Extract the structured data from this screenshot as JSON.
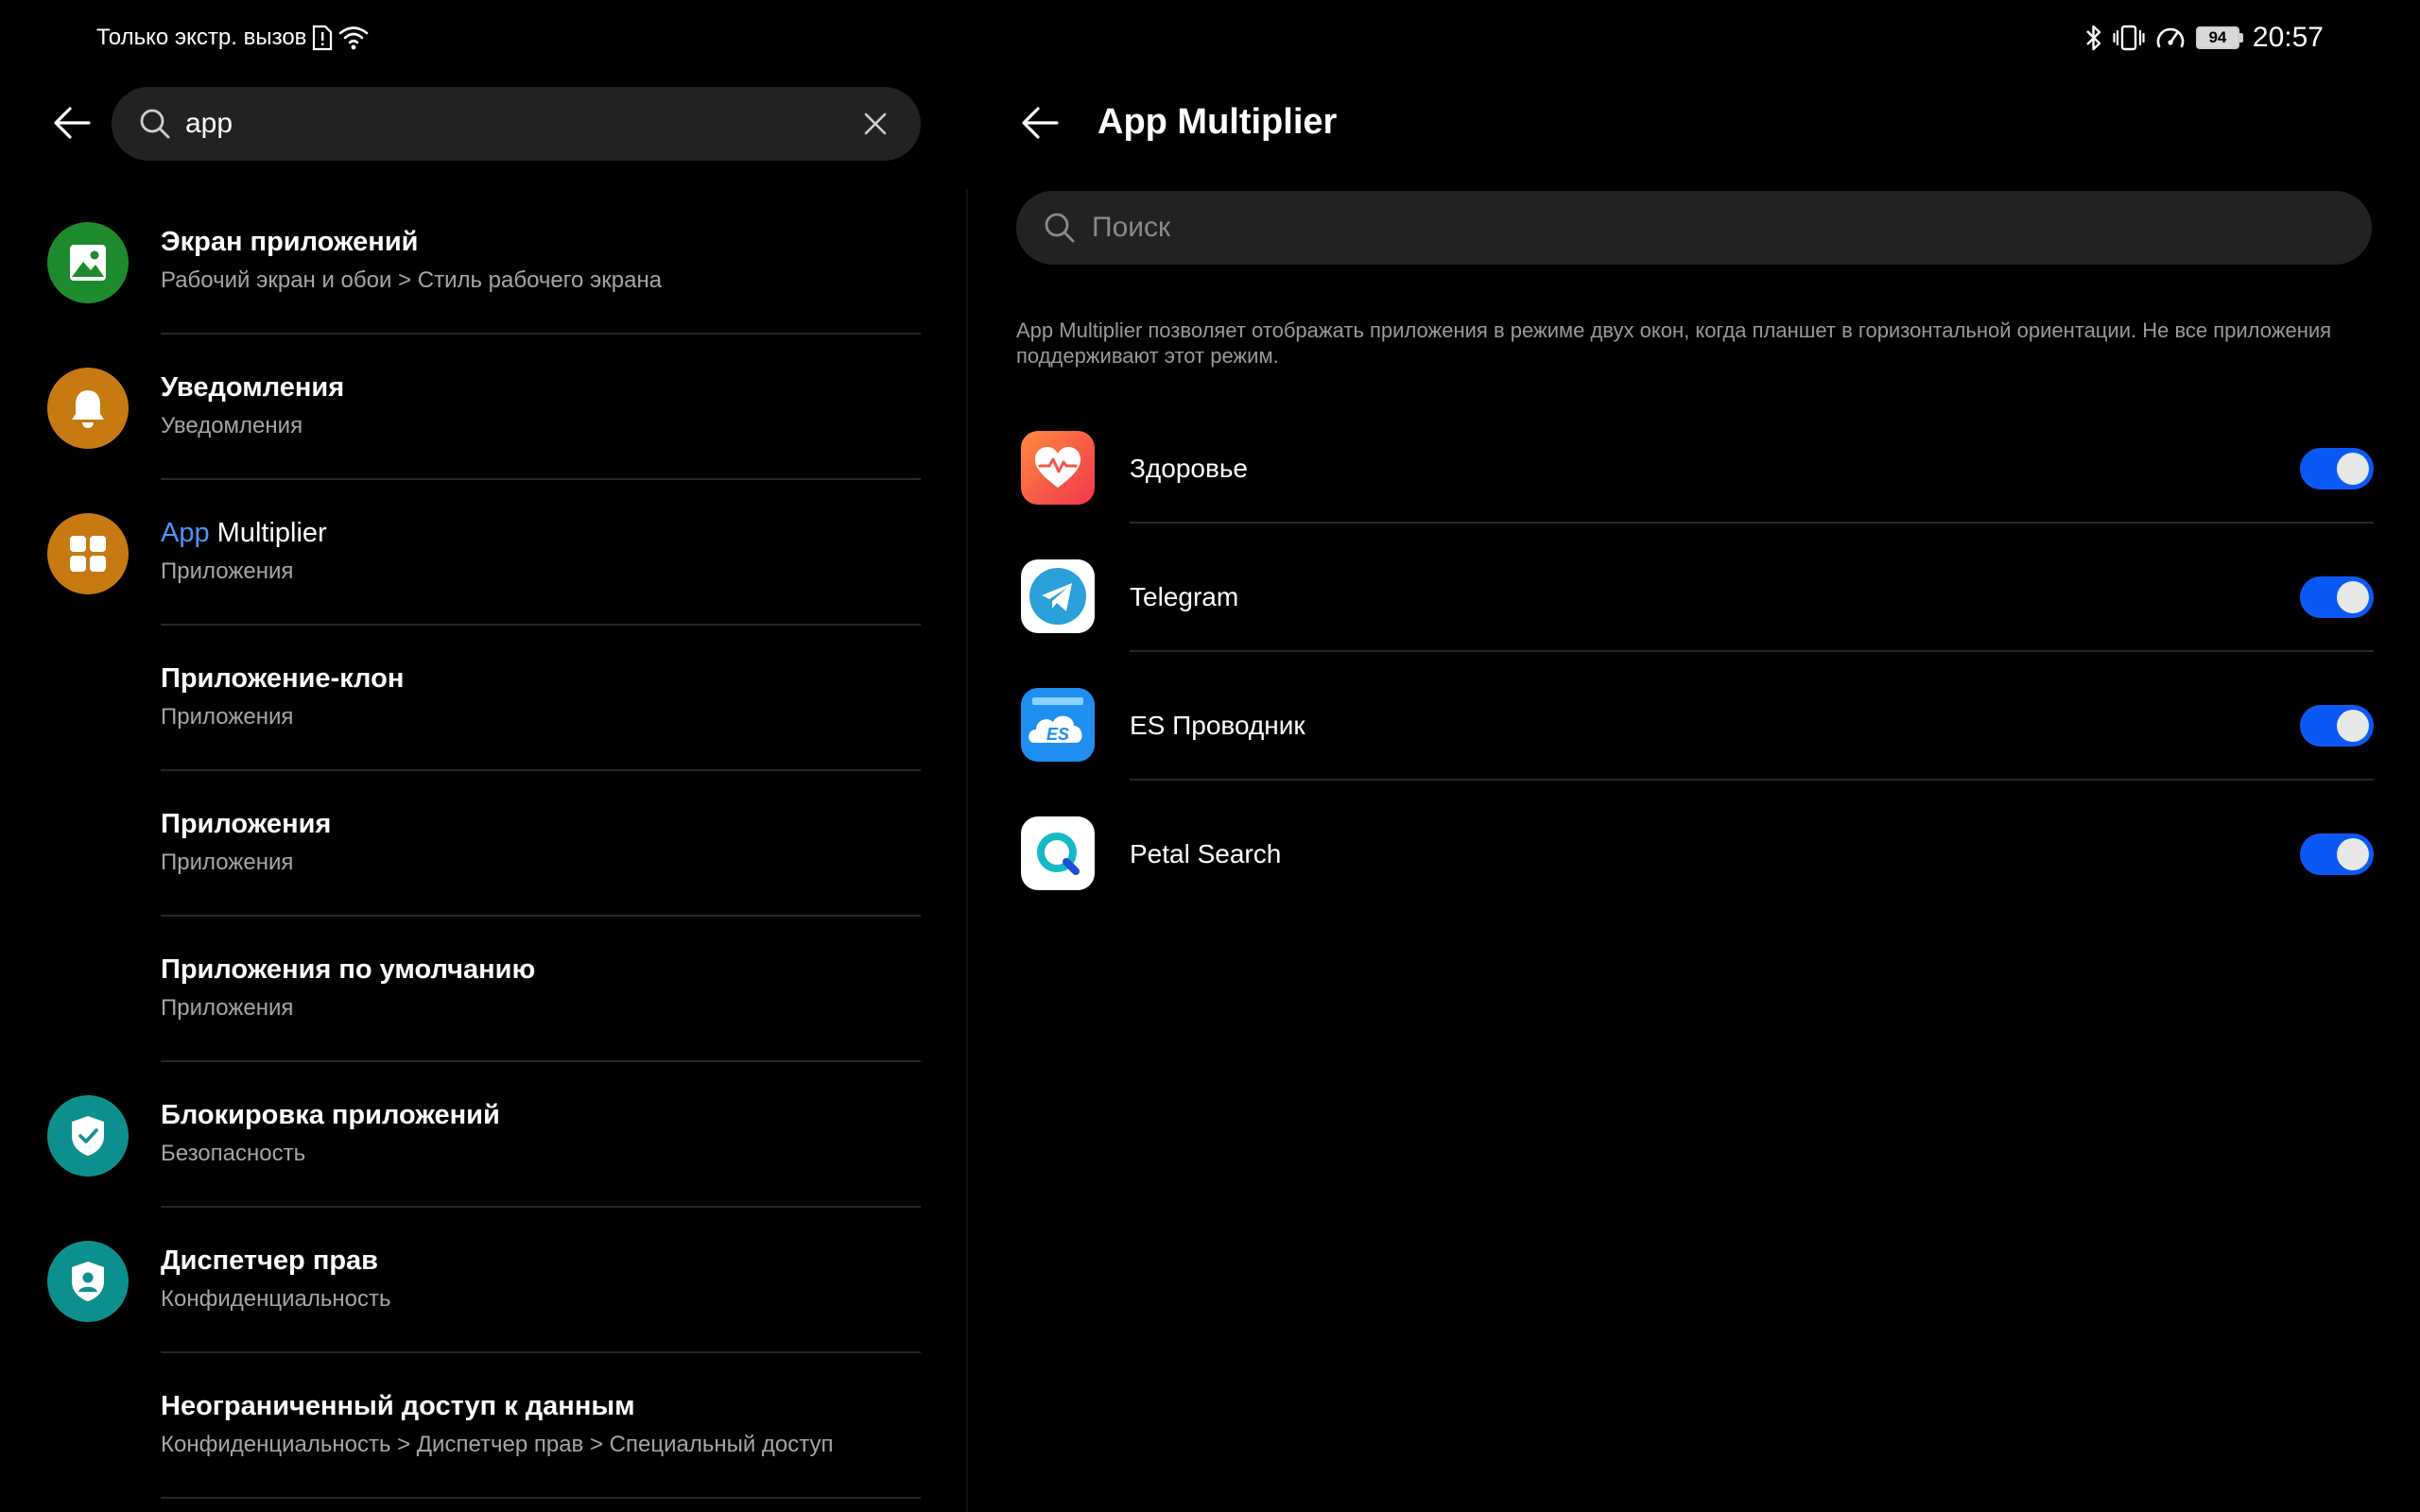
{
  "status_bar": {
    "left_text": "Только экстр. вызов",
    "time": "20:57",
    "battery": "94",
    "icons": [
      "sim-alert-icon",
      "wifi-icon",
      "bluetooth-icon",
      "vibrate-icon",
      "speed-icon",
      "battery-icon"
    ]
  },
  "search": {
    "query": "app",
    "icon": "search-icon",
    "clear_icon": "close-icon"
  },
  "results": [
    {
      "title": "Экран приложений",
      "subtitle": "Рабочий экран и обои > Стиль рабочего экрана",
      "icon": "image-icon",
      "icon_color": "#1e8a2e"
    },
    {
      "title": "Уведомления",
      "subtitle": "Уведомления",
      "icon": "bell-icon",
      "icon_color": "#c77a12"
    },
    {
      "title_highlight": "App",
      "title_rest": " Multiplier",
      "subtitle": "Приложения",
      "icon": "grid-icon",
      "icon_color": "#c77a12"
    },
    {
      "title": "Приложение-клон",
      "subtitle": "Приложения"
    },
    {
      "title": "Приложения",
      "subtitle": "Приложения"
    },
    {
      "title": "Приложения по умолчанию",
      "subtitle": "Приложения"
    },
    {
      "title": "Блокировка приложений",
      "subtitle": "Безопасность",
      "icon": "shield-check-icon",
      "icon_color": "#0e8f8f"
    },
    {
      "title": "Диспетчер прав",
      "subtitle": "Конфиденциальность",
      "icon": "shield-user-icon",
      "icon_color": "#0e8f8f"
    },
    {
      "title": "Неограниченный доступ к данным",
      "subtitle": "Конфиденциальность > Диспетчер прав > Специальный доступ"
    }
  ],
  "detail": {
    "title": "App Multiplier",
    "search_placeholder": "Поиск",
    "description": "App Multiplier позволяет отображать приложения в режиме двух окон, когда планшет в горизонтальной ориентации. Не все приложения поддерживают этот режим.",
    "apps": [
      {
        "name": "Здоровье",
        "icon": "health-icon",
        "enabled": true
      },
      {
        "name": "Telegram",
        "icon": "telegram-icon",
        "enabled": true
      },
      {
        "name": "ES Проводник",
        "icon": "es-explorer-icon",
        "enabled": true
      },
      {
        "name": "Petal Search",
        "icon": "petal-search-icon",
        "enabled": true
      }
    ]
  },
  "colors": {
    "accent": "#0a59f7",
    "highlight": "#4d95f7",
    "background": "#000000",
    "surface": "#222222"
  }
}
